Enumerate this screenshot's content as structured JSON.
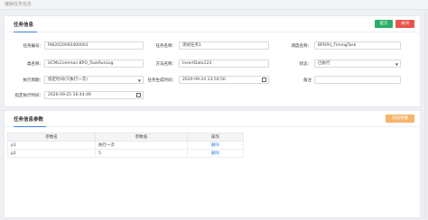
{
  "window": {
    "title": "编辑任务信息"
  },
  "task_panel": {
    "title": "任务信息",
    "save_label": "提交",
    "close_label": "关闭",
    "fields": {
      "task_no_label": "任务编号：",
      "task_no_value": "RW2020092400001",
      "task_name_label": "任务名称：",
      "task_name_value": "测试任务1",
      "job_name_label": "调度名称：",
      "job_name_value": "BPOPrj_TimingTask",
      "class_name_label": "类名称：",
      "class_name_value": "UCMLCommon.BPO_TaskRunLog",
      "method_name_label": "方法名称：",
      "method_name_value": "InsertData123",
      "status_label": "状态：",
      "status_value": "已执行",
      "period_label": "执行周期：",
      "period_value": "指定时间(只执行一次)",
      "gen_time_label": "任务生成时间：",
      "gen_time_value": "2020-09-24 13:50:50",
      "remark_label": "备注",
      "remark_value": "",
      "exec_time_label": "指定执行时间：",
      "exec_time_value": "2020-09-25 16:44:49"
    }
  },
  "param_panel": {
    "title": "任务信息参数",
    "add_label": "添加参数",
    "columns": [
      "参数名",
      "参数值",
      "操作"
    ],
    "rows": [
      {
        "name": "p1",
        "value": "执行一次",
        "op": "删除"
      },
      {
        "name": "p2",
        "value": "5",
        "op": "删除"
      }
    ]
  }
}
